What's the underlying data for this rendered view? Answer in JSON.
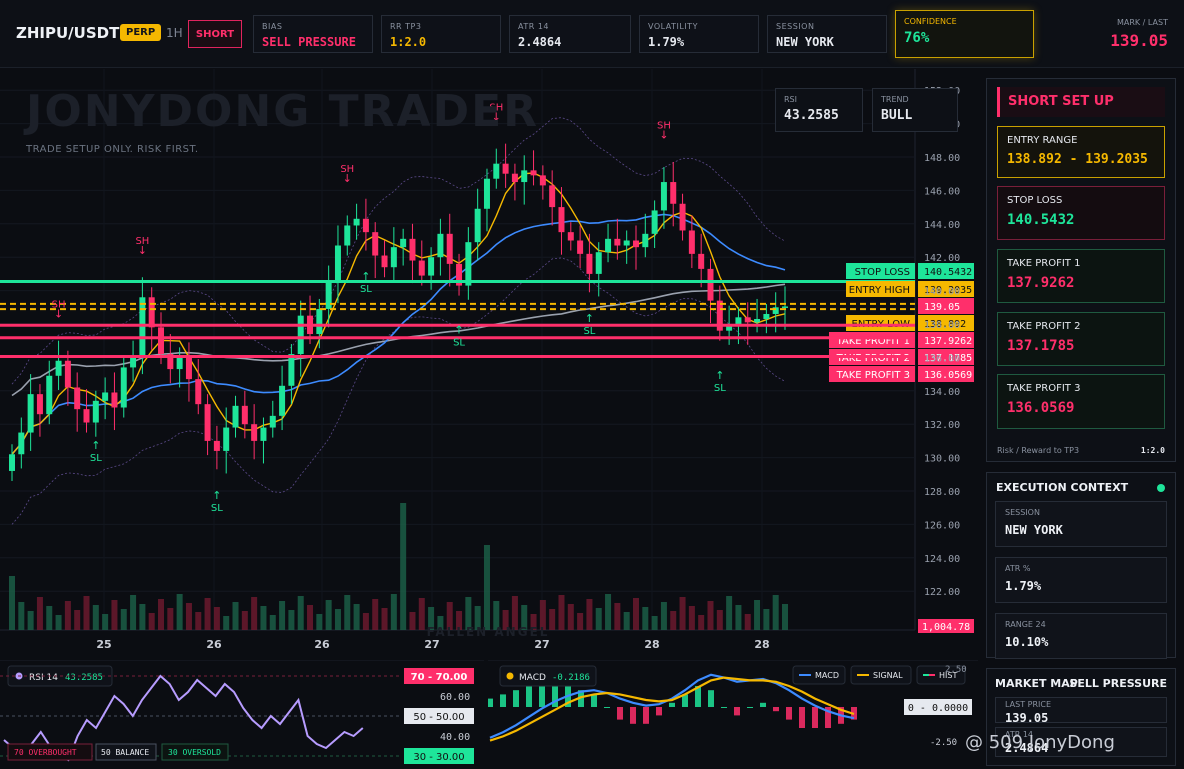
{
  "header": {
    "symbol": "ZHIPU/USDT",
    "perp": "PERP",
    "timeframe": "1H",
    "direction": "SHORT",
    "stats": [
      {
        "label": "BIAS",
        "value": "SELL PRESSURE",
        "color": "#ff2f6b"
      },
      {
        "label": "RR TP3",
        "value": "1:2.0",
        "color": "#f5b800"
      },
      {
        "label": "ATR 14",
        "value": "2.4864",
        "color": "#e6e9ef"
      },
      {
        "label": "VOLATILITY",
        "value": "1.79%",
        "color": "#e6e9ef"
      },
      {
        "label": "SESSION",
        "value": "NEW YORK",
        "color": "#e6e9ef"
      }
    ],
    "confidence_label": "CONFIDENCE",
    "confidence_value": "76%",
    "mark_label": "MARK / LAST",
    "mark_value": "139.05"
  },
  "chart": {
    "watermark": "JONYDONG TRADER",
    "subtitle": "TRADE SETUP ONLY. RISK FIRST.",
    "rsi_box": {
      "label": "RSI",
      "value": "43.2585"
    },
    "trend_box": {
      "label": "TREND",
      "value": "BULL"
    },
    "center_watermark": "FALLEN ANGEL",
    "price_axis": [
      "152.00",
      "150.00",
      "148.00",
      "146.00",
      "144.00",
      "142.00",
      "140.00",
      "138.00",
      "136.00",
      "134.00",
      "132.00",
      "130.00",
      "128.00",
      "126.00",
      "124.00",
      "122.00"
    ],
    "date_axis": [
      "25",
      "26",
      "26",
      "27",
      "27",
      "28",
      "28"
    ],
    "volume_tag": "1,004.78",
    "last_tag": "139.05",
    "levels": [
      {
        "name": "STOP LOSS",
        "value": "140.5432",
        "price": 140.5432,
        "color": "#1ee59a",
        "style": "solid"
      },
      {
        "name": "ENTRY HIGH",
        "value": "139.2035",
        "price": 139.2035,
        "color": "#f5b800",
        "style": "dashed"
      },
      {
        "name": "ENTRY LOW",
        "value": "138.892",
        "price": 138.892,
        "color": "#f5b800",
        "style": "dashed"
      },
      {
        "name": "TAKE PROFIT 1",
        "value": "137.9262",
        "price": 137.9262,
        "color": "#ff2f6b",
        "style": "solid"
      },
      {
        "name": "TAKE PROFIT 2",
        "value": "137.1785",
        "price": 137.1785,
        "color": "#ff2f6b",
        "style": "solid"
      },
      {
        "name": "TAKE PROFIT 3",
        "value": "136.0569",
        "price": 136.0569,
        "color": "#ff2f6b",
        "style": "solid"
      }
    ],
    "markers": {
      "sh": "SH",
      "sl": "SL"
    }
  },
  "panel": {
    "title": "SHORT SET UP",
    "entry_label": "ENTRY RANGE",
    "entry_value": "138.892 - 139.2035",
    "stop_label": "STOP LOSS",
    "stop_value": "140.5432",
    "tp1_label": "TAKE PROFIT 1",
    "tp1_value": "137.9262",
    "tp2_label": "TAKE PROFIT 2",
    "tp2_value": "137.1785",
    "tp3_label": "TAKE PROFIT 3",
    "tp3_value": "136.0569",
    "rr_label": "Risk / Reward to TP3",
    "rr_value": "1:2.0"
  },
  "execution": {
    "title": "EXECUTION CONTEXT",
    "session_label": "SESSION",
    "session_value": "NEW YORK",
    "atr_label": "ATR %",
    "atr_value": "1.79%",
    "range_label": "RANGE 24",
    "range_value": "10.10%"
  },
  "market_map": {
    "title": "MARKET MAP",
    "bias": "SELL PRESSURE",
    "last_label": "LAST PRICE",
    "last_value": "139.05",
    "atr_label": "ATR 14",
    "atr_value": "2.4864"
  },
  "rsi": {
    "label": "RSI 14",
    "value": "43.2585",
    "overbought_tag": "70 - 70.00",
    "mid_tag": "50 - 50.00",
    "oversold_tag": "30 - 30.00",
    "axis_60": "60.00",
    "axis_40": "40.00",
    "legend_ob": "70 OVERBOUGHT",
    "legend_bal": "50 BALANCE",
    "legend_os": "30 OVERSOLD",
    "values": [
      38,
      34,
      30,
      36,
      42,
      35,
      30,
      28,
      40,
      48,
      44,
      52,
      60,
      56,
      50,
      58,
      64,
      70,
      66,
      58,
      62,
      68,
      64,
      60,
      66,
      62,
      54,
      48,
      44,
      50,
      46,
      52,
      58,
      40,
      36,
      34,
      38,
      42,
      40,
      44
    ]
  },
  "macd": {
    "label": "MACD",
    "value": "-0.2186",
    "legend_macd": "MACD",
    "legend_signal": "SIGNAL",
    "legend_hist": "HIST",
    "axis_top": "2.50",
    "zero_tag": "0 - 0.0000",
    "axis_bottom": "-2.50",
    "macd_values": [
      -2.2,
      -1.8,
      -1.3,
      -0.7,
      -0.1,
      0.4,
      0.8,
      1.1,
      1.2,
      1.0,
      0.6,
      0.3,
      0.1,
      0.2,
      0.6,
      1.2,
      1.9,
      2.3,
      2.1,
      1.8,
      1.9,
      2.0,
      1.7,
      1.2,
      0.6,
      0.1,
      -0.3,
      -0.6,
      -0.8
    ],
    "signal_values": [
      -2.4,
      -2.1,
      -1.7,
      -1.2,
      -0.7,
      -0.2,
      0.3,
      0.7,
      0.9,
      1.0,
      0.9,
      0.7,
      0.5,
      0.4,
      0.5,
      0.9,
      1.4,
      1.9,
      2.1,
      2.0,
      1.9,
      1.9,
      1.8,
      1.5,
      1.1,
      0.6,
      0.2,
      -0.2,
      -0.5
    ]
  },
  "footer": {
    "mark": "@ 509 JonyDong"
  }
}
